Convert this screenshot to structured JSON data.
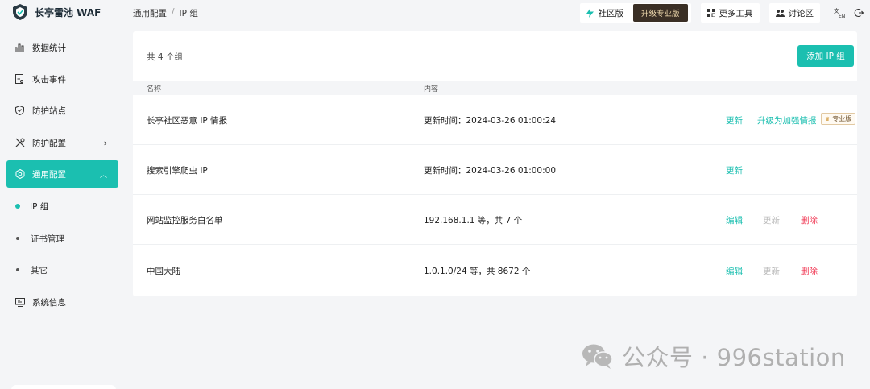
{
  "app": {
    "title": "长亭雷池 WAF"
  },
  "sidebar": {
    "items": [
      {
        "label": "数据统计"
      },
      {
        "label": "攻击事件"
      },
      {
        "label": "防护站点"
      },
      {
        "label": "防护配置"
      },
      {
        "label": "通用配置"
      },
      {
        "label": "系统信息"
      }
    ],
    "sub_items": [
      {
        "label": "IP 组"
      },
      {
        "label": "证书管理"
      },
      {
        "label": "其它"
      }
    ]
  },
  "breadcrumb": {
    "parent": "通用配置",
    "sep": "/",
    "current": "IP 组"
  },
  "topbar": {
    "community": "社区版",
    "upgrade": "升级专业版",
    "tools": "更多工具",
    "forum": "讨论区"
  },
  "main": {
    "count_text": "共 4 个组",
    "add_button": "添加 IP 组",
    "columns": {
      "name": "名称",
      "content": "内容"
    },
    "rows": [
      {
        "name": "长亭社区恶意 IP 情报",
        "content": "更新时间：2024-03-26 01:00:24",
        "update": "更新",
        "upgrade": "升级为加强情报",
        "pro": "专业版"
      },
      {
        "name": "搜索引擎爬虫 IP",
        "content": "更新时间：2024-03-26 01:00:00",
        "update": "更新"
      },
      {
        "name": "网站监控服务白名单",
        "content": "192.168.1.1 等，共 7 个",
        "edit": "编辑",
        "update": "更新",
        "delete": "删除"
      },
      {
        "name": "中国大陆",
        "content": "1.0.1.0/24 等，共 8672 个",
        "edit": "编辑",
        "update": "更新",
        "delete": "删除"
      }
    ]
  },
  "watermark": {
    "text": "公众号 · 996station"
  },
  "colors": {
    "accent": "#1bbfb0",
    "danger": "#f0304d",
    "upgrade_bg": "#3a2f25"
  }
}
